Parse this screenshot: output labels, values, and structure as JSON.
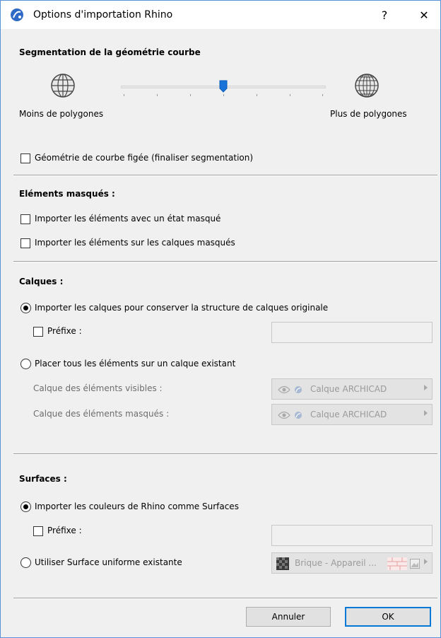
{
  "window": {
    "title": "Options d'importation Rhino",
    "help_label": "?",
    "close_label": "✕"
  },
  "segmentation": {
    "heading": "Segmentation de la géométrie courbe",
    "fewer_label": "Moins de polygones",
    "more_label": "Plus de polygones",
    "slider_value": 0.5,
    "frozen_label": "Géométrie de courbe figée (finaliser segmentation)",
    "frozen_checked": false
  },
  "hidden": {
    "heading": "Eléments masqués :",
    "import_hidden_state_label": "Importer les éléments avec un état masqué",
    "import_hidden_layers_label": "Importer les éléments sur les calques masqués"
  },
  "layers": {
    "heading": "Calques :",
    "option_keep_label": "Importer les calques pour conserver la structure de calques originale",
    "prefix_label": "Préfixe :",
    "prefix_value": "",
    "option_place_label": "Placer tous les éléments sur un calque existant",
    "visible_label": "Calque des éléments visibles :",
    "visible_value": "Calque ARCHICAD",
    "hidden_label": "Calque des éléments masqués :",
    "hidden_value": "Calque ARCHICAD"
  },
  "surfaces": {
    "heading": "Surfaces :",
    "option_colors_label": "Importer les couleurs de Rhino comme Surfaces",
    "prefix_label": "Préfixe :",
    "prefix_value": "",
    "option_uniform_label": "Utiliser Surface uniforme existante",
    "surface_value": "Brique - Appareil ..."
  },
  "footer": {
    "cancel_label": "Annuler",
    "ok_label": "OK"
  },
  "colors": {
    "accent": "#0078d7",
    "slider_thumb": "#1a73d9",
    "app_icon": "#2f6bc6"
  }
}
